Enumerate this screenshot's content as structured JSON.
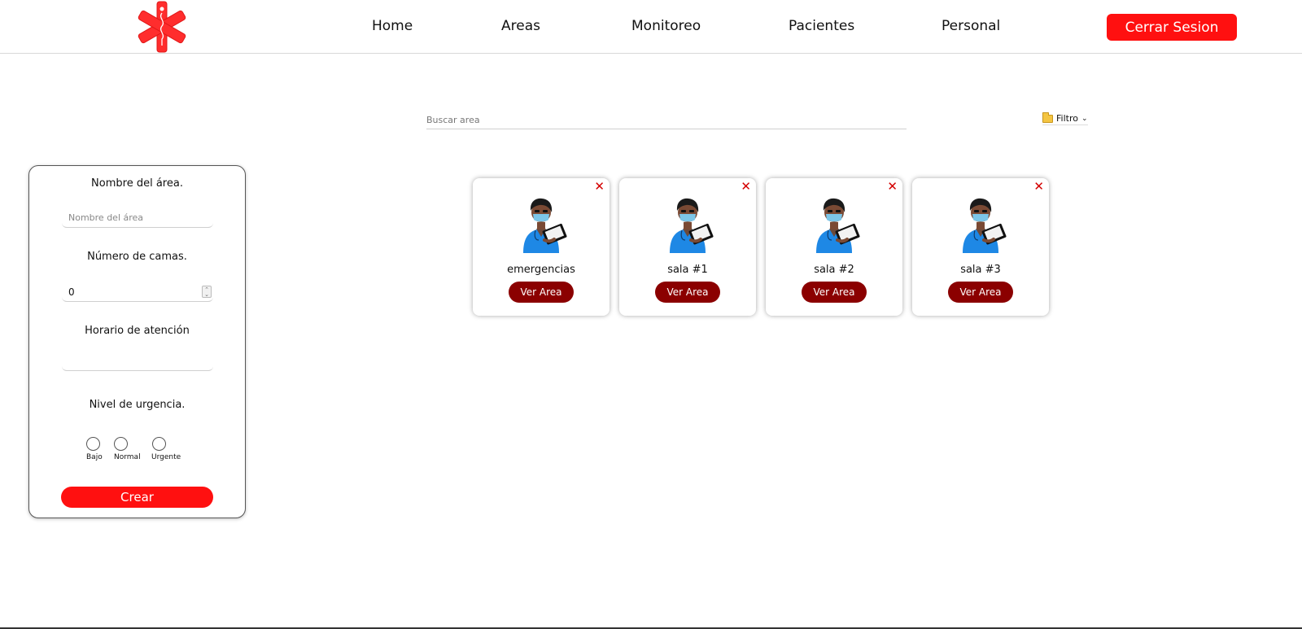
{
  "header": {
    "nav": [
      "Home",
      "Areas",
      "Monitoreo",
      "Pacientes",
      "Personal"
    ],
    "logout_label": "Cerrar Sesion",
    "accent_color": "#ff1010"
  },
  "search": {
    "placeholder": "Buscar area",
    "filter_label": "Filtro",
    "filter_icon": "folder-icon"
  },
  "form": {
    "name_label": "Nombre del área.",
    "name_placeholder": "Nombre del área",
    "beds_label": "Número de camas.",
    "beds_value": "0",
    "schedule_label": "Horario de atención",
    "urgency_label": "Nivel de urgencia.",
    "urgency_options": [
      "Bajo",
      "Normal",
      "Urgente"
    ],
    "create_label": "Crear"
  },
  "cards": [
    {
      "title": "emergencias",
      "button": "Ver Area"
    },
    {
      "title": "sala #1",
      "button": "Ver Area"
    },
    {
      "title": "sala #2",
      "button": "Ver Area"
    },
    {
      "title": "sala #3",
      "button": "Ver Area"
    }
  ],
  "colors": {
    "card_button": "#8b0000",
    "close_icon": "#d40000"
  }
}
